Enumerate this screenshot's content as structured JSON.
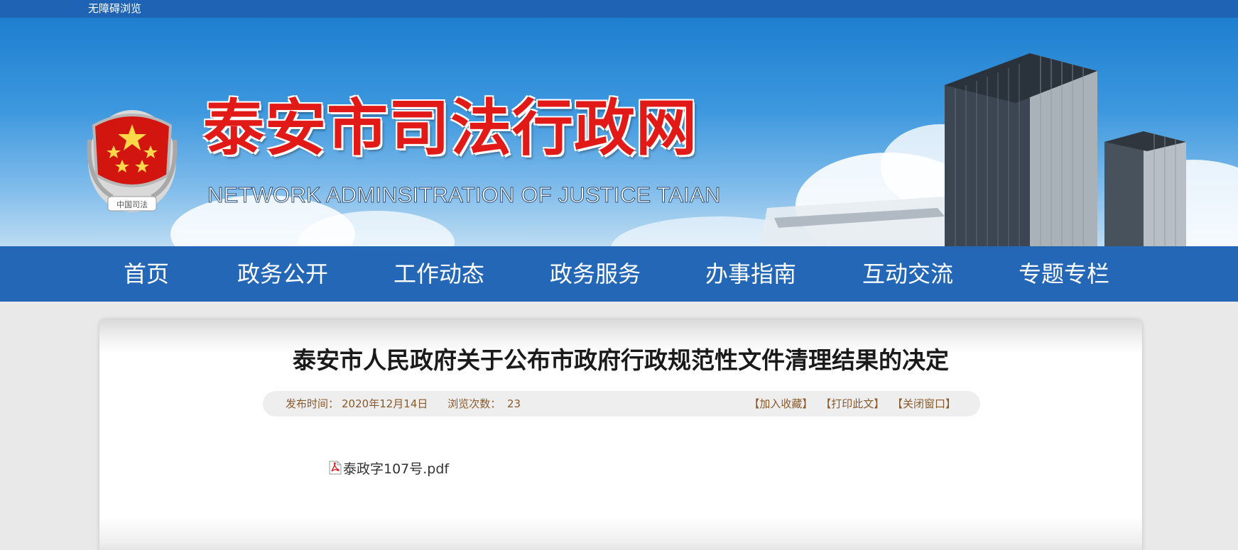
{
  "topbar": {
    "accessibility_label": "无障碍浏览"
  },
  "header": {
    "title": "泰安市司法行政网",
    "subtitle": "NETWORK ADMINSITRATION OF JUSTICE TAIAN",
    "emblem_text": "中国司法"
  },
  "nav": {
    "items": [
      {
        "label": "首页"
      },
      {
        "label": "政务公开"
      },
      {
        "label": "工作动态"
      },
      {
        "label": "政务服务"
      },
      {
        "label": "办事指南"
      },
      {
        "label": "互动交流"
      },
      {
        "label": "专题专栏"
      }
    ]
  },
  "article": {
    "title": "泰安市人民政府关于公布市政府行政规范性文件清理结果的决定",
    "meta": {
      "publish_label": "发布时间：",
      "publish_date": "2020年12月14日",
      "views_label": "浏览次数：",
      "views": "23",
      "actions": [
        "【加入收藏】",
        "【打印此文】",
        "【关闭窗口】"
      ]
    },
    "attachment": {
      "name": "泰政字107号.pdf",
      "icon": "pdf-icon"
    }
  },
  "colors": {
    "topbar": "#1f63b5",
    "nav": "#2467b7",
    "title_red": "#e21a17",
    "meta_text": "#8a5a2b",
    "page_bg": "#e9e9e9"
  }
}
